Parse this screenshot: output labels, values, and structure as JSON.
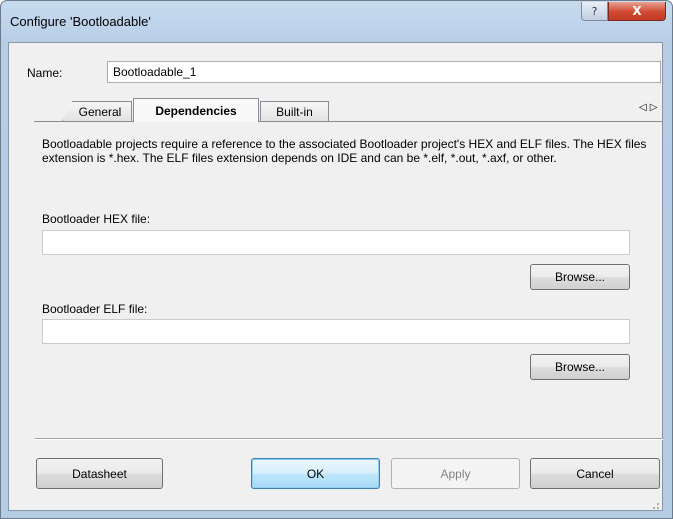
{
  "window": {
    "title": "Configure 'Bootloadable'",
    "help_glyph": "?",
    "close_glyph": "X"
  },
  "name_field": {
    "label": "Name:",
    "value": "Bootloadable_1"
  },
  "tabs": [
    {
      "label": "General",
      "active": false
    },
    {
      "label": "Dependencies",
      "active": true
    },
    {
      "label": "Built-in",
      "active": false
    }
  ],
  "tab_scroll": {
    "left": "◁",
    "right": "▷"
  },
  "dependencies": {
    "description": "Bootloadable projects require a reference to the associated Bootloader project's HEX and ELF files. The HEX files extension is *.hex. The ELF files extension depends on IDE and can be *.elf, *.out, *.axf, or other.",
    "hex_label": "Bootloader HEX file:",
    "hex_value": "",
    "elf_label": "Bootloader ELF file:",
    "elf_value": "",
    "browse_label": "Browse..."
  },
  "footer": {
    "datasheet": "Datasheet",
    "ok": "OK",
    "apply": "Apply",
    "cancel": "Cancel"
  },
  "colors": {
    "title_bar": "#bcd2ea",
    "close_button": "#c9432c",
    "default_button_border": "#3c7fb1",
    "dialog_background": "#f0f0f0"
  }
}
